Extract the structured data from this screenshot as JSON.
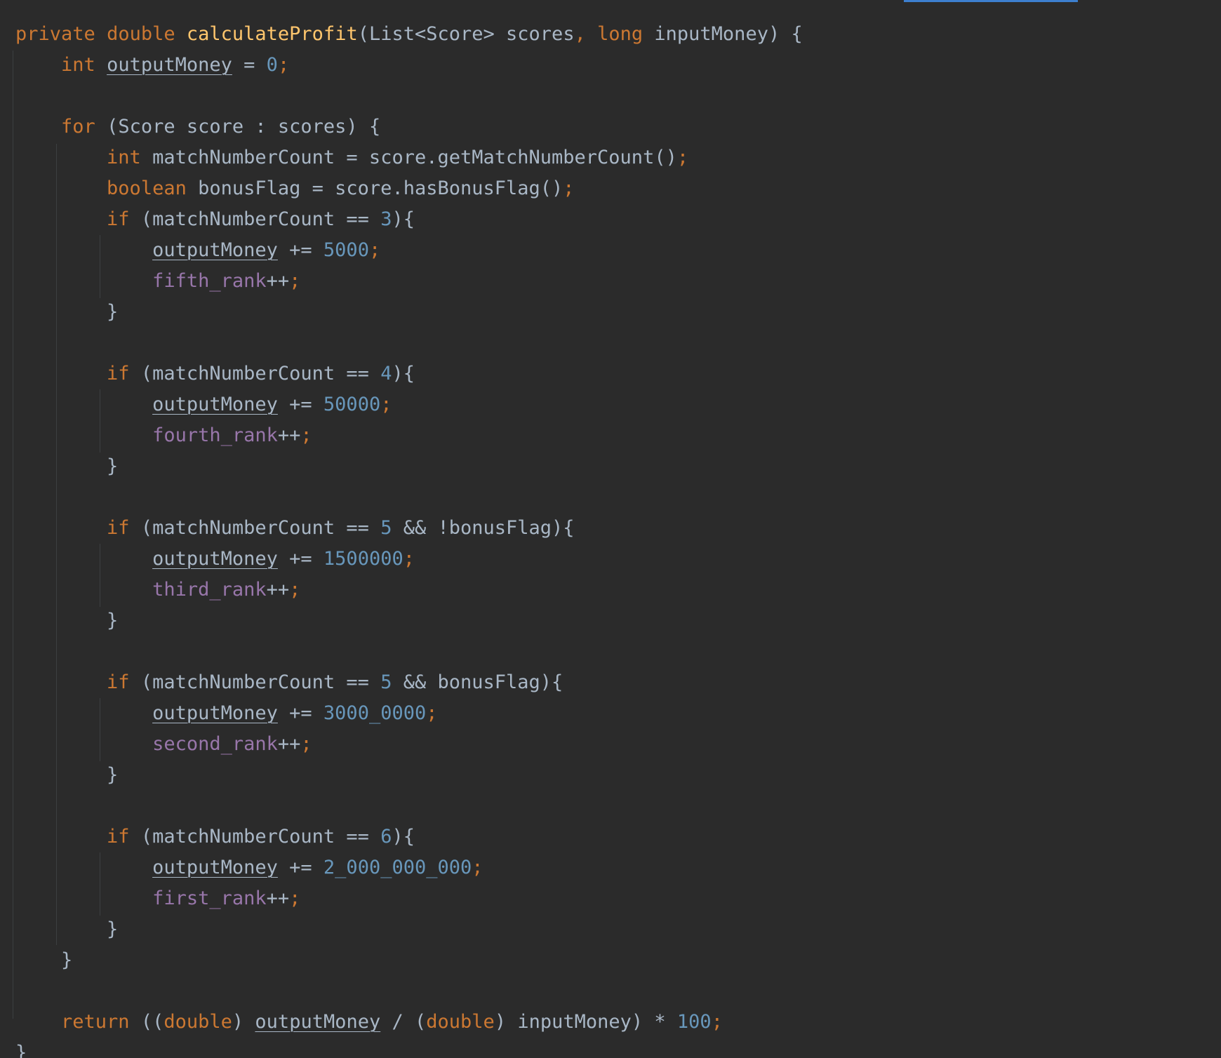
{
  "editor": {
    "theme_colors": {
      "background": "#2b2b2b",
      "keyword": "#cc7832",
      "function": "#ffc66d",
      "number": "#6897bb",
      "field": "#9876aa",
      "text": "#a9b7c6",
      "scroll_indicator": "#3d7fcf"
    },
    "lines": [
      [
        [
          "kw",
          "private"
        ],
        [
          "plain",
          " "
        ],
        [
          "kw",
          "double"
        ],
        [
          "plain",
          " "
        ],
        [
          "fn",
          "calculateProfit"
        ],
        [
          "plain",
          "(List<Score> scores"
        ],
        [
          "punct",
          ","
        ],
        [
          "plain",
          " "
        ],
        [
          "kw",
          "long"
        ],
        [
          "plain",
          " inputMoney) {"
        ]
      ],
      [
        [
          "plain",
          "    "
        ],
        [
          "kw",
          "int"
        ],
        [
          "plain",
          " "
        ],
        [
          "var",
          "outputMoney"
        ],
        [
          "plain",
          " = "
        ],
        [
          "num",
          "0"
        ],
        [
          "punct",
          ";"
        ]
      ],
      [],
      [
        [
          "plain",
          "    "
        ],
        [
          "kw",
          "for"
        ],
        [
          "plain",
          " (Score score : scores) {"
        ]
      ],
      [
        [
          "plain",
          "        "
        ],
        [
          "kw",
          "int"
        ],
        [
          "plain",
          " matchNumberCount = score.getMatchNumberCount()"
        ],
        [
          "punct",
          ";"
        ]
      ],
      [
        [
          "plain",
          "        "
        ],
        [
          "kw",
          "boolean"
        ],
        [
          "plain",
          " bonusFlag = score.hasBonusFlag()"
        ],
        [
          "punct",
          ";"
        ]
      ],
      [
        [
          "plain",
          "        "
        ],
        [
          "kw",
          "if"
        ],
        [
          "plain",
          " (matchNumberCount == "
        ],
        [
          "num",
          "3"
        ],
        [
          "plain",
          "){"
        ]
      ],
      [
        [
          "plain",
          "            "
        ],
        [
          "var",
          "outputMoney"
        ],
        [
          "plain",
          " += "
        ],
        [
          "num",
          "5000"
        ],
        [
          "punct",
          ";"
        ]
      ],
      [
        [
          "plain",
          "            "
        ],
        [
          "field",
          "fifth_rank"
        ],
        [
          "plain",
          "++"
        ],
        [
          "punct",
          ";"
        ]
      ],
      [
        [
          "plain",
          "        }"
        ]
      ],
      [],
      [
        [
          "plain",
          "        "
        ],
        [
          "kw",
          "if"
        ],
        [
          "plain",
          " (matchNumberCount == "
        ],
        [
          "num",
          "4"
        ],
        [
          "plain",
          "){"
        ]
      ],
      [
        [
          "plain",
          "            "
        ],
        [
          "var",
          "outputMoney"
        ],
        [
          "plain",
          " += "
        ],
        [
          "num",
          "50000"
        ],
        [
          "punct",
          ";"
        ]
      ],
      [
        [
          "plain",
          "            "
        ],
        [
          "field",
          "fourth_rank"
        ],
        [
          "plain",
          "++"
        ],
        [
          "punct",
          ";"
        ]
      ],
      [
        [
          "plain",
          "        }"
        ]
      ],
      [],
      [
        [
          "plain",
          "        "
        ],
        [
          "kw",
          "if"
        ],
        [
          "plain",
          " (matchNumberCount == "
        ],
        [
          "num",
          "5"
        ],
        [
          "plain",
          " && !bonusFlag){"
        ]
      ],
      [
        [
          "plain",
          "            "
        ],
        [
          "var",
          "outputMoney"
        ],
        [
          "plain",
          " += "
        ],
        [
          "num",
          "1500000"
        ],
        [
          "punct",
          ";"
        ]
      ],
      [
        [
          "plain",
          "            "
        ],
        [
          "field",
          "third_rank"
        ],
        [
          "plain",
          "++"
        ],
        [
          "punct",
          ";"
        ]
      ],
      [
        [
          "plain",
          "        }"
        ]
      ],
      [],
      [
        [
          "plain",
          "        "
        ],
        [
          "kw",
          "if"
        ],
        [
          "plain",
          " (matchNumberCount == "
        ],
        [
          "num",
          "5"
        ],
        [
          "plain",
          " && bonusFlag){"
        ]
      ],
      [
        [
          "plain",
          "            "
        ],
        [
          "var",
          "outputMoney"
        ],
        [
          "plain",
          " += "
        ],
        [
          "num",
          "3000_0000"
        ],
        [
          "punct",
          ";"
        ]
      ],
      [
        [
          "plain",
          "            "
        ],
        [
          "field",
          "second_rank"
        ],
        [
          "plain",
          "++"
        ],
        [
          "punct",
          ";"
        ]
      ],
      [
        [
          "plain",
          "        }"
        ]
      ],
      [],
      [
        [
          "plain",
          "        "
        ],
        [
          "kw",
          "if"
        ],
        [
          "plain",
          " (matchNumberCount == "
        ],
        [
          "num",
          "6"
        ],
        [
          "plain",
          "){"
        ]
      ],
      [
        [
          "plain",
          "            "
        ],
        [
          "var",
          "outputMoney"
        ],
        [
          "plain",
          " += "
        ],
        [
          "num",
          "2_000_000_000"
        ],
        [
          "punct",
          ";"
        ]
      ],
      [
        [
          "plain",
          "            "
        ],
        [
          "field",
          "first_rank"
        ],
        [
          "plain",
          "++"
        ],
        [
          "punct",
          ";"
        ]
      ],
      [
        [
          "plain",
          "        }"
        ]
      ],
      [
        [
          "plain",
          "    }"
        ]
      ],
      [],
      [
        [
          "plain",
          "    "
        ],
        [
          "kw",
          "return"
        ],
        [
          "plain",
          " (("
        ],
        [
          "kw",
          "double"
        ],
        [
          "plain",
          ") "
        ],
        [
          "var",
          "outputMoney"
        ],
        [
          "plain",
          " / ("
        ],
        [
          "kw",
          "double"
        ],
        [
          "plain",
          ") inputMoney) * "
        ],
        [
          "num",
          "100"
        ],
        [
          "punct",
          ";"
        ]
      ],
      [
        [
          "plain",
          "}"
        ]
      ]
    ]
  }
}
